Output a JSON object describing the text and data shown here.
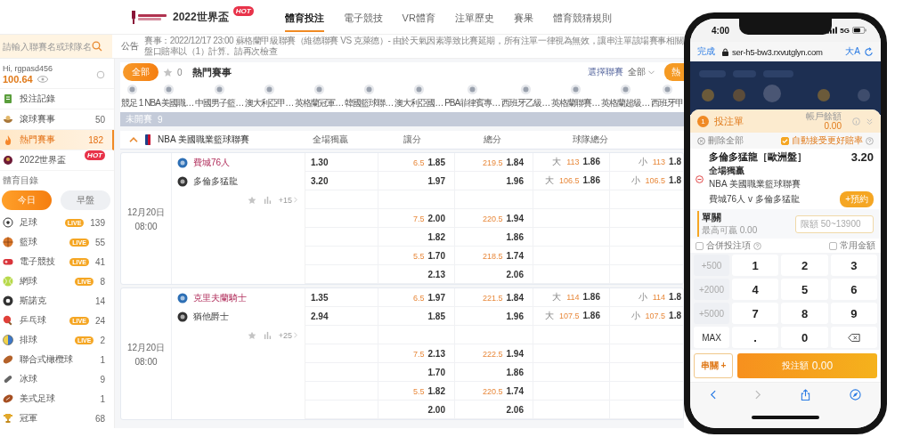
{
  "top_nav": {
    "event": "2022世界盃",
    "event_badge": "HOT",
    "tabs": [
      {
        "label": "體育投注",
        "selected": true
      },
      {
        "label": "電子競技",
        "selected": false
      },
      {
        "label": "VR體育",
        "selected": false
      },
      {
        "label": "注單歷史",
        "selected": false
      },
      {
        "label": "賽果",
        "selected": false
      },
      {
        "label": "體育競猜規則",
        "selected": false
      }
    ]
  },
  "search": {
    "placeholder": "請輸入聯賽名或球隊名"
  },
  "announcement": {
    "label": "公告",
    "text": "賽事：2022/12/17 23:00 蘇格蘭甲級聯賽（維德聯賽 VS 克萊德）- 由於天氣因素導致比賽延期，所有注單一律視為無效，讓串注單該場賽事相關盤口賠率以（1）計算。請再次檢查"
  },
  "account": {
    "greeting": "Hi, rgpasd456",
    "balance": "100.64"
  },
  "menu": [
    {
      "label": "投注記錄",
      "selected": false
    },
    {
      "label": "滾球賽事",
      "count": "50",
      "selected": false
    },
    {
      "label": "熱門賽事",
      "count": "182",
      "selected": true
    },
    {
      "label": "2022世界盃",
      "badge": "HOT",
      "selected": false
    }
  ],
  "catalog": {
    "title": "體育目錄",
    "periods": [
      {
        "label": "今日",
        "selected": true
      },
      {
        "label": "早盤",
        "selected": false
      }
    ],
    "sports": [
      {
        "name": "足球",
        "live": "LIVE",
        "count": "139"
      },
      {
        "name": "籃球",
        "live": "LIVE",
        "count": "55"
      },
      {
        "name": "電子競技",
        "live": "LIVE",
        "count": "41"
      },
      {
        "name": "網球",
        "live": "LIVE",
        "count": "8"
      },
      {
        "name": "斯諾克",
        "count": "14"
      },
      {
        "name": "乒乓球",
        "live": "LIVE",
        "count": "24"
      },
      {
        "name": "排球",
        "live": "LIVE",
        "count": "2"
      },
      {
        "name": "聯合式橄欖球",
        "count": "1"
      },
      {
        "name": "冰球",
        "count": "9"
      },
      {
        "name": "美式足球",
        "count": "1"
      },
      {
        "name": "冠軍",
        "count": "68"
      }
    ]
  },
  "main": {
    "all": {
      "label": "全部",
      "selected": true
    },
    "favorites": "0",
    "title": "熱門賽事",
    "league_filter": {
      "label": "選擇聯賽",
      "value": "全部"
    },
    "hot_button": "熱",
    "leagues": [
      "競足 1",
      "NBA 美國職…",
      "中國男子籃…",
      "澳大利亞甲…",
      "英格蘭冠軍…",
      "韓國籃球聯…",
      "澳大利亞國…",
      "PBA菲律賓專…",
      "西班牙乙級…",
      "英格蘭聯賽…",
      "英格蘭超級…",
      "西班牙甲"
    ],
    "upcoming": {
      "label": "未開賽",
      "count": "9"
    },
    "league": {
      "name": "NBA 美國職業籃球聯賽",
      "expanded": true,
      "columns": [
        "全場獨贏",
        "讓分",
        "總分",
        "球隊總分"
      ]
    },
    "matches": [
      {
        "date": "12月20日",
        "time": "08:00",
        "more": "+15",
        "teams": [
          {
            "name": "費城76人",
            "highlighted": true
          },
          {
            "name": "多倫多猛龍",
            "highlighted": false
          }
        ],
        "main_lines": [
          {
            "win": "1.30",
            "hcp_line": "6.5",
            "hcp": "1.85",
            "tot_line": "219.5",
            "tot": "1.84",
            "over": "大",
            "over_line": "113",
            "over_odds": "1.86",
            "under": "小",
            "under_line": "113",
            "under_odds": "1.8"
          },
          {
            "win": "3.20",
            "hcp": "1.97",
            "tot": "1.96",
            "over": "大",
            "over_line": "106.5",
            "over_odds": "1.86",
            "under": "小",
            "under_line": "106.5",
            "under_odds": "1.8"
          }
        ],
        "alt_lines": [
          {
            "hcp_line": "7.5",
            "hcp": "2.00",
            "tot_line": "220.5",
            "tot": "1.94"
          },
          {
            "hcp": "1.82",
            "tot": "1.86"
          },
          {
            "hcp_line": "5.5",
            "hcp": "1.70",
            "tot_line": "218.5",
            "tot": "1.74"
          },
          {
            "hcp": "2.13",
            "tot": "2.06"
          }
        ]
      },
      {
        "date": "12月20日",
        "time": "08:00",
        "more": "+25",
        "teams": [
          {
            "name": "克里夫蘭騎士",
            "highlighted": true
          },
          {
            "name": "猶他爵士",
            "highlighted": false
          }
        ],
        "main_lines": [
          {
            "win": "1.35",
            "hcp_line": "6.5",
            "hcp": "1.97",
            "tot_line": "221.5",
            "tot": "1.84",
            "over": "大",
            "over_line": "114",
            "over_odds": "1.86",
            "under": "小",
            "under_line": "114",
            "under_odds": "1.8"
          },
          {
            "win": "2.94",
            "hcp": "1.85",
            "tot": "1.96",
            "over": "大",
            "over_line": "107.5",
            "over_odds": "1.86",
            "under": "小",
            "under_line": "107.5",
            "under_odds": "1.8"
          }
        ],
        "alt_lines": [
          {
            "hcp_line": "7.5",
            "hcp": "2.13",
            "tot_line": "222.5",
            "tot": "1.94"
          },
          {
            "hcp": "1.70",
            "tot": "1.86"
          },
          {
            "hcp_line": "5.5",
            "hcp": "1.82",
            "tot_line": "220.5",
            "tot": "1.74"
          },
          {
            "hcp": "2.00",
            "tot": "2.06"
          }
        ]
      }
    ]
  },
  "phone": {
    "time": "4:00",
    "network": "5G",
    "url_bar": {
      "done": "完成",
      "url": "ser-h5-bw3.rxvutglyn.com",
      "text_size": "大A"
    },
    "bet_slip": {
      "count": "1",
      "title": "投注單",
      "balance_label": "帳戶餘額",
      "balance": "0.00",
      "delete_all": "刪除全部",
      "auto_accept": {
        "label": "自動接受更好賠率",
        "checked": true
      },
      "bet": {
        "selection": "多倫多猛龍［歐洲盤］",
        "odds": "3.20",
        "market": "全場獨贏",
        "league": "NBA 美國職業籃球聯賽",
        "match": "費城76人 v 多倫多猛龍",
        "reserve": "+預約"
      },
      "single": {
        "title": "單關",
        "max_win": "最高可贏 0.00",
        "placeholder": "限額 50~13900"
      },
      "combine": {
        "label": "合併投注項",
        "checked": false
      },
      "common_amounts": {
        "label": "常用金額",
        "checked": false
      },
      "keypad": {
        "quick": [
          "+500",
          "+2000",
          "+5000",
          "MAX"
        ],
        "keys": [
          "1",
          "2",
          "3",
          "4",
          "5",
          "6",
          "7",
          "8",
          "9",
          ".",
          "0"
        ]
      },
      "parlay": "串關 +",
      "submit": {
        "label": "投注額",
        "amount": "0.00"
      }
    }
  }
}
